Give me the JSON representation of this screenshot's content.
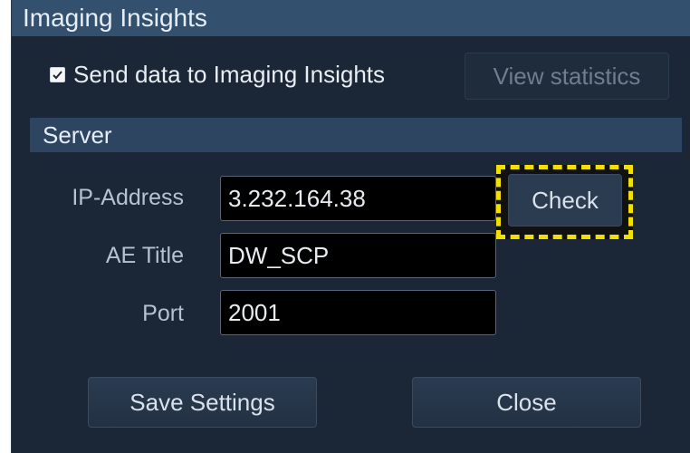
{
  "dialog": {
    "title": "Imaging Insights",
    "send_data_label": "Send data to Imaging Insights",
    "send_data_checked": true,
    "view_statistics_label": "View statistics",
    "view_statistics_enabled": false
  },
  "server": {
    "section_label": "Server",
    "ip_label": "IP-Address",
    "ip_value": "3.232.164.38",
    "ae_label": "AE Title",
    "ae_value": "DW_SCP",
    "port_label": "Port",
    "port_value": "2001",
    "check_label": "Check"
  },
  "footer": {
    "save_label": "Save Settings",
    "close_label": "Close"
  },
  "colors": {
    "background": "#1b2736",
    "titlebar": "#33506f",
    "section_bar": "#2d4561",
    "highlight": "#f2e000"
  }
}
